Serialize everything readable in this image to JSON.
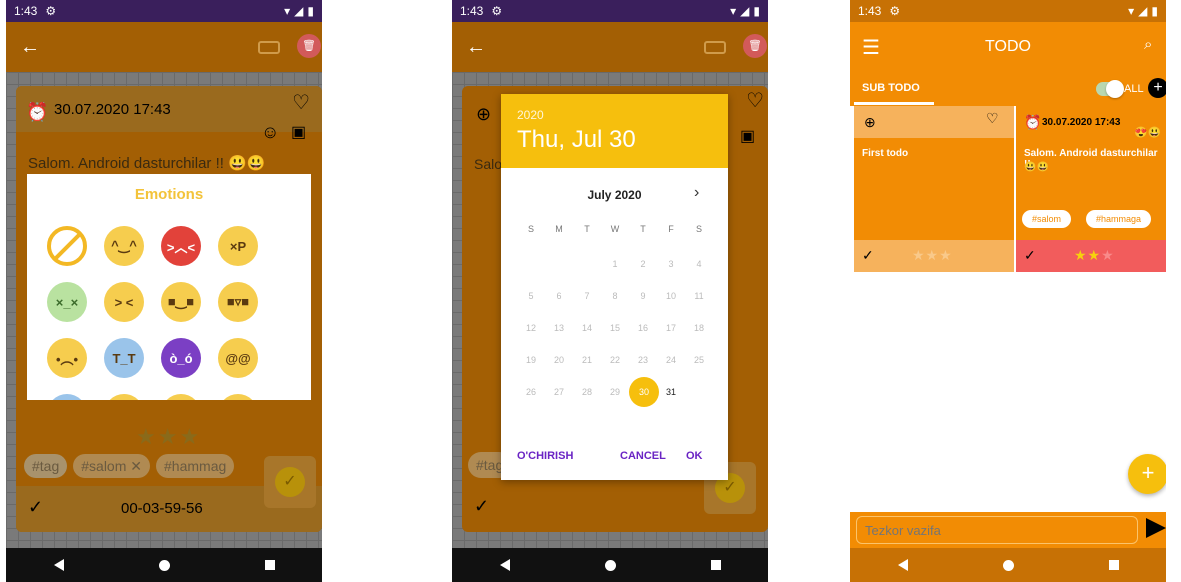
{
  "status": {
    "time": "1:43",
    "settings_icon": "gear-icon"
  },
  "screen1": {
    "card": {
      "date": "30.07.2020 17:43",
      "text": "Salom. Android dasturchilar !! 😃😃",
      "timer": "00-03-59-56",
      "stars": 3,
      "stars_filled": 2,
      "tags": {
        "input_placeholder": "#tag",
        "salom": "#salom",
        "salom_remove": "✕",
        "hammaga": "#hammag"
      }
    },
    "dialog": {
      "title": "Emotions",
      "emotions": [
        "no-emotion",
        "angel",
        "angry",
        "tongue",
        "dizzy",
        "squint",
        "cool",
        "cool-smile",
        "worried",
        "crying",
        "devil",
        "dizzy-eyes",
        "more-1",
        "more-2",
        "more-3",
        "more-4"
      ]
    }
  },
  "screen2": {
    "card": {
      "text": "Salo",
      "tag_placeholder": "#tag"
    },
    "datepicker": {
      "year": "2020",
      "date": "Thu, Jul 30",
      "month": "July 2020",
      "weekdays": [
        "S",
        "M",
        "T",
        "W",
        "T",
        "F",
        "S"
      ],
      "days": [
        "",
        "",
        "",
        "1",
        "2",
        "3",
        "4",
        "5",
        "6",
        "7",
        "8",
        "9",
        "10",
        "11",
        "12",
        "13",
        "14",
        "15",
        "16",
        "17",
        "18",
        "19",
        "20",
        "21",
        "22",
        "23",
        "24",
        "25",
        "26",
        "27",
        "28",
        "29",
        "30",
        "31"
      ],
      "selected_day": "30",
      "clear_label": "O'CHIRISH",
      "cancel_label": "CANCEL",
      "ok_label": "OK"
    }
  },
  "screen3": {
    "title": "TODO",
    "tab_label": "SUB TODO",
    "toggle_label": "ALL",
    "card_a": {
      "text": "First todo",
      "stars": "★★★"
    },
    "card_b": {
      "date": "30.07.2020 17:43",
      "text": "Salom. Android dasturchilar !!",
      "emoji": "😃😃",
      "tags": [
        "#salom",
        "#hammaga"
      ],
      "stars_filled": "★★",
      "stars_empty": "★"
    },
    "fab_label": "+",
    "quick_placeholder": "Tezkor vazifa"
  },
  "colors": {
    "primary": "#f28c04",
    "accent": "#f6bf0d",
    "dialog_accent": "#6a24c4",
    "danger": "#f25c5c"
  }
}
